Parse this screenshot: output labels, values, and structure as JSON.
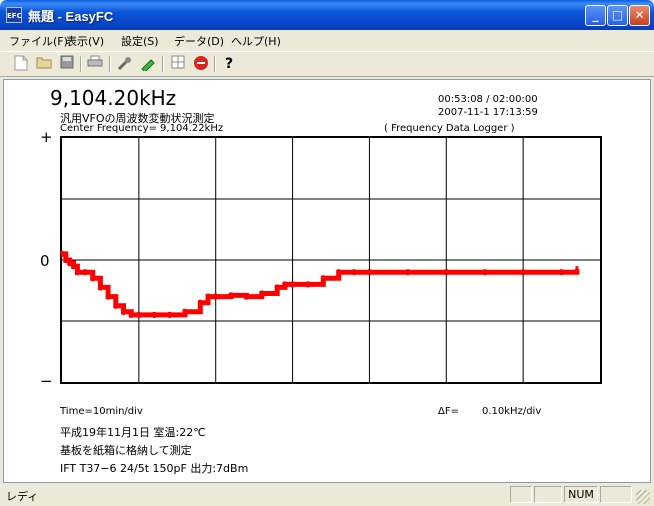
{
  "window": {
    "title": "無題 - EasyFC",
    "icon_text": "EFC"
  },
  "title_buttons": {
    "minimize": "_",
    "maximize": "□",
    "close": "✕"
  },
  "menu": [
    {
      "label": "ファイル(F)"
    },
    {
      "label": "表示(V)"
    },
    {
      "label": "設定(S)"
    },
    {
      "label": "データ(D)"
    },
    {
      "label": "ヘルプ(H)"
    }
  ],
  "toolbar": {
    "icons": [
      "new-file-icon",
      "open-folder-icon",
      "save-icon",
      "print-icon",
      "wrench-icon",
      "pen-icon",
      "grid-icon",
      "stop-icon",
      "help-icon"
    ]
  },
  "display": {
    "frequency": "9,104.20kHz",
    "subtitle": "汎用VFOの周波数変動状況測定",
    "center": "Center Frequency=  9,104.22kHz",
    "elapsed": "00:53:08 / 02:00:00",
    "datetime": "2007-11-1  17:13:59",
    "logger": "( Frequency Data Logger )",
    "y_plus": "+",
    "y_zero": "0",
    "y_minus": "−",
    "time_div": "Time=10min/div",
    "delta_f_label": "ΔF=",
    "delta_f_value": "0.10kHz/div",
    "note1": "平成19年11月1日 室温:22℃",
    "note2": "基板を紙箱に格納して測定",
    "note3": "IFT T37−6 24/5t 150pF 出力:7dBm"
  },
  "chart_data": {
    "type": "line",
    "title": "",
    "xlabel": "Time=10min/div",
    "ylabel": "ΔF=0.10kHz/div",
    "xlim": [
      0,
      70
    ],
    "ylim": [
      -0.2,
      0.2
    ],
    "grid": true,
    "color": "#ff0000",
    "series": [
      {
        "x": [
          0,
          0.5,
          1,
          1.5,
          2,
          3,
          4,
          5,
          6,
          7,
          8,
          9,
          10,
          12,
          14,
          16,
          18,
          19,
          20,
          22,
          24,
          26,
          28,
          29,
          30,
          32,
          34,
          36,
          38,
          40,
          45,
          50,
          55,
          60,
          65,
          67
        ],
        "y": [
          0.01,
          0.0,
          -0.005,
          -0.01,
          -0.02,
          -0.02,
          -0.03,
          -0.045,
          -0.06,
          -0.075,
          -0.085,
          -0.09,
          -0.09,
          -0.09,
          -0.09,
          -0.085,
          -0.07,
          -0.06,
          -0.06,
          -0.058,
          -0.06,
          -0.055,
          -0.045,
          -0.04,
          -0.04,
          -0.04,
          -0.03,
          -0.02,
          -0.02,
          -0.02,
          -0.02,
          -0.02,
          -0.02,
          -0.02,
          -0.02,
          -0.015
        ]
      }
    ]
  },
  "status": {
    "text": "レディ",
    "num": "NUM"
  }
}
